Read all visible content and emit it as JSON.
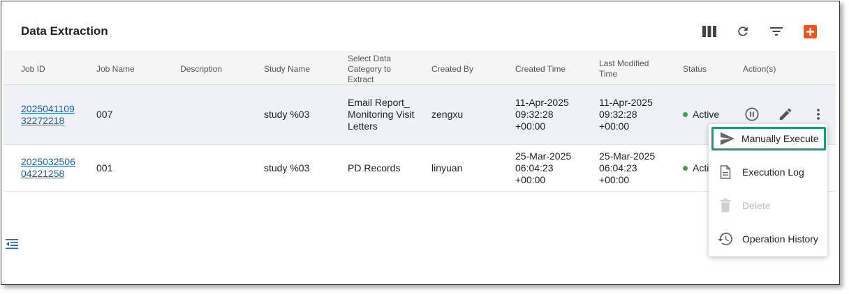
{
  "page": {
    "title": "Data Extraction"
  },
  "toolbar": {
    "columns_icon": "columns-icon",
    "refresh_icon": "refresh-icon",
    "filter_icon": "filter-icon",
    "add_icon": "add-icon",
    "accent": "#f4511e"
  },
  "table": {
    "headers": [
      "Job ID",
      "Job Name",
      "Description",
      "Study Name",
      "Select Data Category to Extract",
      "Created By",
      "Created Time",
      "Last Modified Time",
      "Status",
      "Action(s)"
    ],
    "rows": [
      {
        "job_id_line1": "2025041109",
        "job_id_line2": "32272218",
        "job_name": "007",
        "description": "",
        "study_name": "study %03",
        "category": "Email Report_Monitoring Visit Letters",
        "created_by": "zengxu",
        "created_time_1": "11-Apr-2025",
        "created_time_2": "09:32:28",
        "created_time_3": "+00:00",
        "modified_time_1": "11-Apr-2025",
        "modified_time_2": "09:32:28",
        "modified_time_3": "+00:00",
        "status": "Active"
      },
      {
        "job_id_line1": "2025032506",
        "job_id_line2": "04221258",
        "job_name": "001",
        "description": "",
        "study_name": "study %03",
        "category": "PD Records",
        "created_by": "linyuan",
        "created_time_1": "25-Mar-2025",
        "created_time_2": "06:04:23",
        "created_time_3": "+00:00",
        "modified_time_1": "25-Mar-2025",
        "modified_time_2": "06:04:23",
        "modified_time_3": "+00:00",
        "status": "Acti"
      }
    ]
  },
  "menu": {
    "items": [
      {
        "label": "Manually Execute",
        "icon": "send-icon"
      },
      {
        "label": "Execution Log",
        "icon": "document-icon"
      },
      {
        "label": "Delete",
        "icon": "trash-icon",
        "disabled": true
      },
      {
        "label": "Operation History",
        "icon": "history-icon"
      }
    ]
  },
  "colors": {
    "status_active": "#43a047",
    "link": "#1f5ea8",
    "highlight": "#1a9a7a"
  }
}
